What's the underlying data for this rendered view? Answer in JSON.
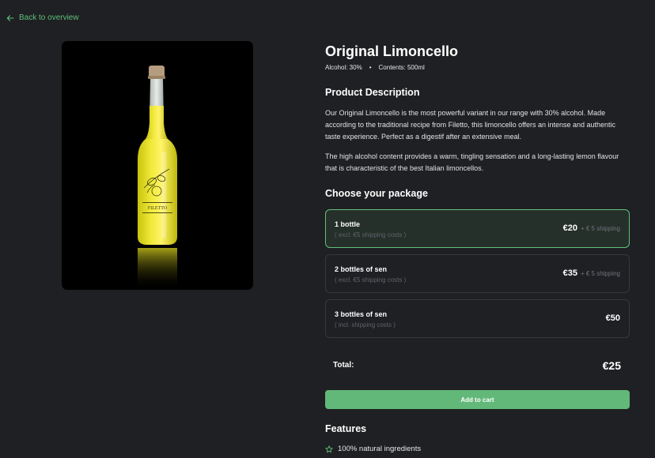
{
  "nav": {
    "back_label": "Back to overview"
  },
  "product": {
    "title": "Original Limoncello",
    "alcohol": "Alcohol: 30%",
    "contents": "Contents: 500ml",
    "bottle_label": "FILETTO"
  },
  "description": {
    "heading": "Product Description",
    "paragraph_1": "Our Original Limoncello is the most powerful variant in our range with 30% alcohol. Made according to the traditional recipe from Filetto, this limoncello offers an intense and authentic taste experience. Perfect as a digestif after an extensive meal.",
    "paragraph_2": "The high alcohol content provides a warm, tingling sensation and a long-lasting lemon flavour that is characteristic of the best Italian limoncellos."
  },
  "packages": {
    "heading": "Choose your package",
    "items": [
      {
        "name": "1 bottle",
        "note": "( excl. €5 shipping costs )",
        "price": "€20",
        "shipping": "+ € 5 shipping",
        "selected": true
      },
      {
        "name": "2 bottles of sen",
        "note": "( excl. €5 shipping costs )",
        "price": "€35",
        "shipping": "+ € 5 shipping",
        "selected": false
      },
      {
        "name": "3 bottles of sen",
        "note": "( incl. shipping costs )",
        "price": "€50",
        "shipping": "",
        "selected": false
      }
    ]
  },
  "total": {
    "label": "Total:",
    "value": "€25"
  },
  "cart": {
    "button_label": "Add to cart"
  },
  "features": {
    "heading": "Features",
    "items": [
      "100% natural ingredients"
    ]
  },
  "colors": {
    "background": "#1f2023",
    "accent": "#5fbf7a",
    "button": "#62b879",
    "selected_card": "#26302a",
    "card_border": "#36383d"
  },
  "icons": {
    "back": "arrow-left-icon",
    "feature": "star-icon"
  }
}
